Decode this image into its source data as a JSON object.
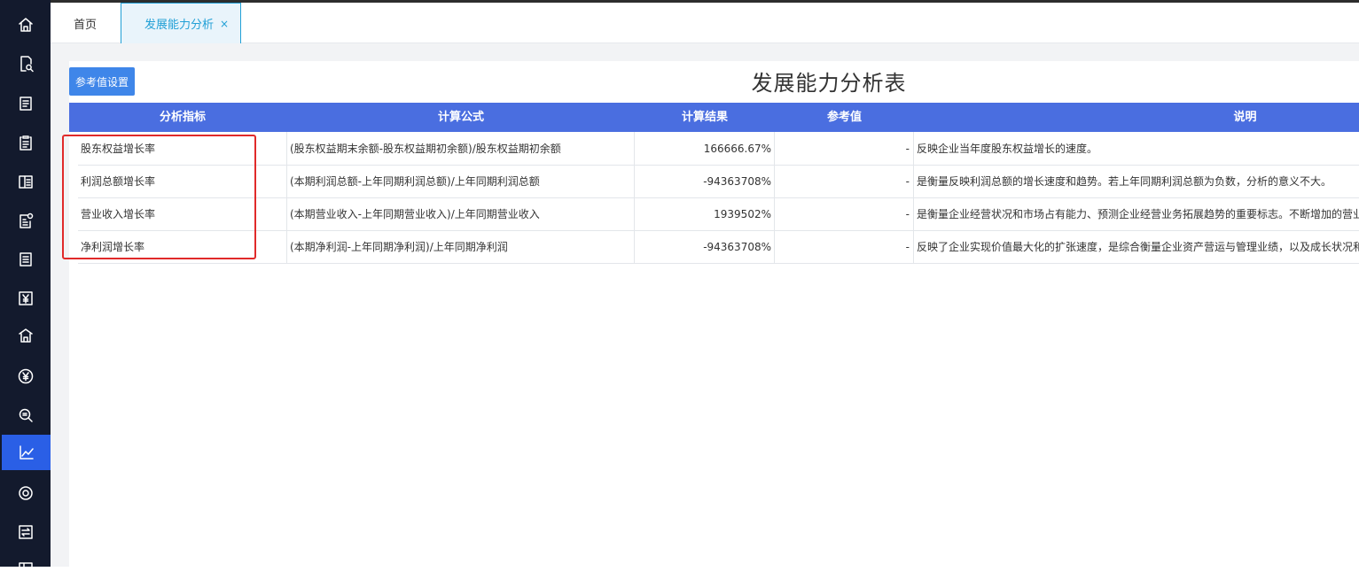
{
  "sidebar": {
    "icons": [
      "home-icon",
      "search-document-icon",
      "list-document-icon",
      "clipboard-icon",
      "book-icon",
      "document-settings-icon",
      "notes-icon",
      "yen-icon",
      "bank-icon",
      "yen-circle-icon",
      "coin-search-icon",
      "line-chart-icon",
      "gear-icon",
      "transfer-icon",
      "grid-icon"
    ],
    "active_index": 11
  },
  "tabs": {
    "home": "首页",
    "active": "发展能力分析",
    "close": "×"
  },
  "toolbar": {
    "ref_button": "参考值设置"
  },
  "page_title": "发展能力分析表",
  "table": {
    "headers": [
      "分析指标",
      "计算公式",
      "计算结果",
      "参考值",
      "说明"
    ],
    "rows": [
      {
        "indicator": "股东权益增长率",
        "formula": "(股东权益期末余额-股东权益期初余额)/股东权益期初余额",
        "result": "166666.67%",
        "reference": "-",
        "description": "反映企业当年度股东权益增长的速度。"
      },
      {
        "indicator": "利润总额增长率",
        "formula": "(本期利润总额-上年同期利润总额)/上年同期利润总额",
        "result": "-94363708%",
        "reference": "-",
        "description": "是衡量反映利润总额的增长速度和趋势。若上年同期利润总额为负数，分析的意义不大。"
      },
      {
        "indicator": "营业收入增长率",
        "formula": "(本期营业收入-上年同期营业收入)/上年同期营业收入",
        "result": "1939502%",
        "reference": "-",
        "description": "是衡量企业经营状况和市场占有能力、预测企业经营业务拓展趋势的重要标志。不断增加的营业"
      },
      {
        "indicator": "净利润增长率",
        "formula": "(本期净利润-上年同期净利润)/上年同期净利润",
        "result": "-94363708%",
        "reference": "-",
        "description": "反映了企业实现价值最大化的扩张速度，是综合衡量企业资产营运与管理业绩，以及成长状况和"
      }
    ]
  },
  "colors": {
    "sidebar_bg": "#131a2d",
    "sidebar_active": "#2a5fe6",
    "header_bg": "#4a6ee0",
    "tab_accent": "#22a0d6",
    "button_bg": "#3f86e9",
    "highlight_box": "#e02a2a"
  }
}
